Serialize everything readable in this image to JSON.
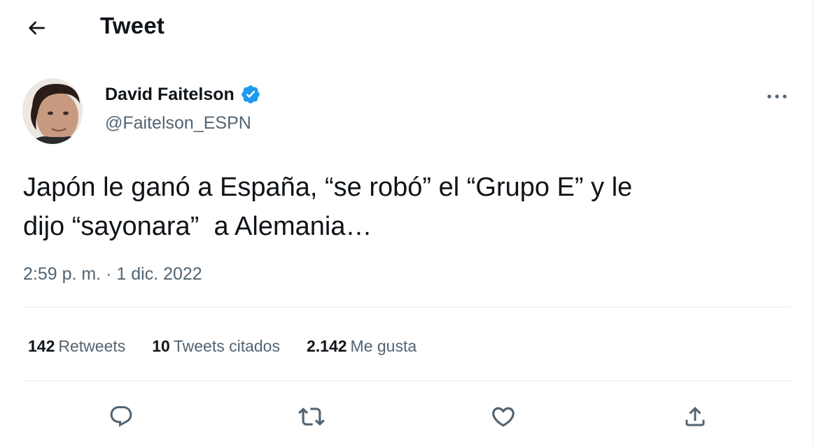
{
  "header": {
    "title": "Tweet",
    "back_icon": "arrow-left-icon"
  },
  "author": {
    "name": "David Faitelson",
    "handle": "@Faitelson_ESPN",
    "verified": true,
    "verified_color": "#1d9bf0"
  },
  "tweet": {
    "text": "Japón le ganó a España, “se robó” el “Grupo E” y le\ndijo “sayonara”  a Alemania…",
    "timestamp": "2:59 p. m. · 1 dic. 2022"
  },
  "stats": {
    "retweets_count": "142",
    "retweets_label": "Retweets",
    "quotes_count": "10",
    "quotes_label": "Tweets citados",
    "likes_count": "2.142",
    "likes_label": "Me gusta"
  },
  "actions": {
    "icons": [
      "reply-icon",
      "retweet-icon",
      "like-icon",
      "share-icon"
    ]
  },
  "colors": {
    "text_primary": "#0f1419",
    "text_secondary": "#536471",
    "divider": "#eff3f4"
  }
}
